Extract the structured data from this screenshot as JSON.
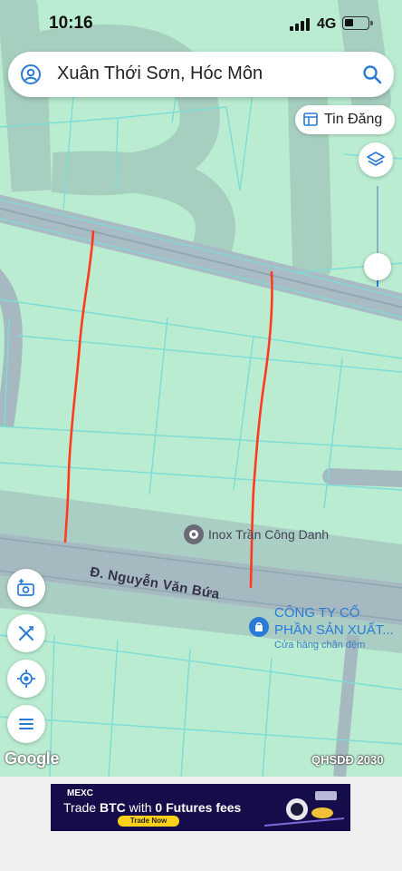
{
  "status_bar": {
    "time": "10:16",
    "network": "4G"
  },
  "search": {
    "query": "Xuân Thới Sơn, Hóc Môn"
  },
  "listing_button": {
    "label": "Tin Đăng"
  },
  "map": {
    "road_label": "Đ. Nguyễn Văn Bứa",
    "poi_1": {
      "name": "Inox Trần Công Danh"
    },
    "poi_2": {
      "name_line1": "CÔNG TY CỔ",
      "name_line2": "PHẦN SẢN XUẤT...",
      "category": "Cửa hàng chăn đệm"
    },
    "google_logo": "Google",
    "overlay_label": "QHSDĐ 2030"
  },
  "ad": {
    "brand": "MEXC",
    "headline_pre": "Trade ",
    "headline_bold1": "BTC",
    "headline_mid": " with ",
    "headline_bold2": "0 Futures fees",
    "cta": "Trade Now"
  },
  "colors": {
    "map_bg": "#b9ecd0",
    "road": "#a7b9c0",
    "parcel_line": "#7ddcd6",
    "marker": "#ff3b1f",
    "accent": "#2b7bd6"
  }
}
